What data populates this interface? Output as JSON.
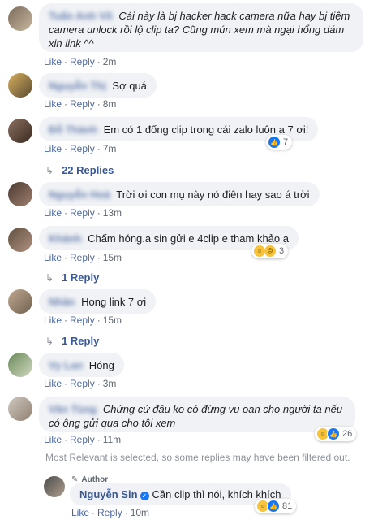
{
  "comments": [
    {
      "author": "Tuấn Anh Võ",
      "text": "Cái này là bị hacker hack camera nữa hay bị tiệm camera unlock rồi lộ clip ta? Cũng mún xem mà ngại hổng dám xin link ^^",
      "like": "Like",
      "reply": "Reply",
      "time": "2m"
    },
    {
      "author": "Nguyễn Thị",
      "text": "Sợ quá",
      "like": "Like",
      "reply": "Reply",
      "time": "8m"
    },
    {
      "author": "Đỗ Thành",
      "text": "Em có 1 đống clip trong cái zalo luôn a 7 ơi!",
      "like": "Like",
      "reply": "Reply",
      "time": "7m",
      "reaction_count": "7",
      "replies": "22 Replies"
    },
    {
      "author": "Nguyễn Hoà",
      "text": "Trời ơi con mụ này nó điên hay sao á trời",
      "like": "Like",
      "reply": "Reply",
      "time": "13m"
    },
    {
      "author": "Khánh",
      "text": "Chấm hóng.a sin gửi e 4clip e tham khảo ạ",
      "like": "Like",
      "reply": "Reply",
      "time": "15m",
      "reaction_count": "3",
      "replies": "1 Reply"
    },
    {
      "author": "Nhân",
      "text": "Hong link 7 ơi",
      "like": "Like",
      "reply": "Reply",
      "time": "15m",
      "replies": "1 Reply"
    },
    {
      "author": "Vy Lan",
      "text": "Hóng",
      "like": "Like",
      "reply": "Reply",
      "time": "3m"
    },
    {
      "author": "Văn Tùng",
      "text": "Chứng cứ đâu ko có đừng vu oan cho người ta nếu có ông gửi qua cho tôi xem",
      "like": "Like",
      "reply": "Reply",
      "time": "11m",
      "reaction_count": "26"
    }
  ],
  "filter_note": "Most Relevant is selected, so some replies may have been filtered out.",
  "author_reply": {
    "badge": "Author",
    "name": "Nguyễn Sin",
    "text": "Cần clip thì nói, khích khích",
    "like": "Like",
    "reply": "Reply",
    "time": "10m",
    "reaction_count": "81"
  },
  "colors": {
    "link": "#385898",
    "bubble": "#f0f2f5",
    "meta": "#606770",
    "like_icon": "#1877f2"
  }
}
